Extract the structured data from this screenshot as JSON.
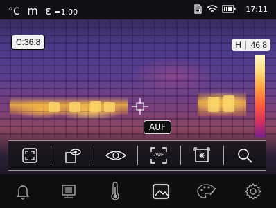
{
  "statusbar": {
    "unit": "°C",
    "mode_m": "m",
    "epsilon_symbol": "ε",
    "emissivity": "=1.00",
    "time": "17:11",
    "icons": [
      "sd-card-icon",
      "wifi-icon",
      "battery-icon"
    ]
  },
  "overlays": {
    "center_temp": "C:36.8",
    "high_prefix": "H",
    "high_value": "46.8",
    "focus_mode": "AUF"
  },
  "toolbar": {
    "items": [
      {
        "name": "fullscreen-icon"
      },
      {
        "name": "camera-overlay-icon"
      },
      {
        "name": "view-eye-icon"
      },
      {
        "name": "auto-focus-icon",
        "label": "AUF"
      },
      {
        "name": "hotspot-frame-icon"
      },
      {
        "name": "zoom-icon"
      }
    ]
  },
  "navbar": {
    "items": [
      {
        "name": "alarm-bell-icon"
      },
      {
        "name": "monitor-display-icon"
      },
      {
        "name": "thermometer-icon"
      },
      {
        "name": "image-gallery-icon",
        "active": true
      },
      {
        "name": "palette-icon"
      },
      {
        "name": "settings-gear-icon"
      }
    ]
  },
  "colors": {
    "accent": "#ffffff",
    "badge_bg": "#f2f2f2",
    "bar_bg": "#0e0d0f"
  }
}
